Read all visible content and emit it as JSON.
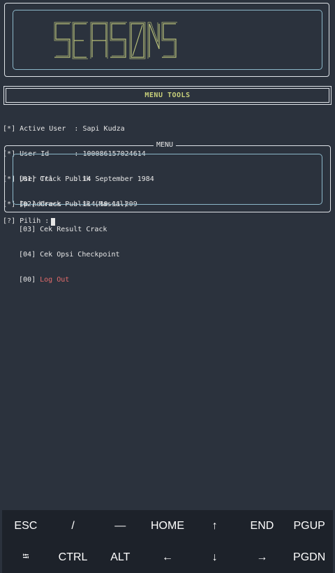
{
  "banner": {
    "logo_text": "SEASONS"
  },
  "menu_tools": {
    "title": "MENU TOOLS"
  },
  "user_info": [
    {
      "marker": "*",
      "label": "Active User",
      "value": "Sapi Kudza"
    },
    {
      "marker": "*",
      "label": "User Id",
      "value": "100086157024614"
    },
    {
      "marker": "*",
      "label": "User Ttl",
      "value": "14 September 1984"
    },
    {
      "marker": "*",
      "label": "Ip Address",
      "value": "114.10.11.209"
    }
  ],
  "menu": {
    "label": "MENU",
    "items": [
      {
        "num": "01",
        "label": "Crack Publik"
      },
      {
        "num": "02",
        "label": "Crack Publik (Massal)"
      },
      {
        "num": "03",
        "label": "Cek Result Crack"
      },
      {
        "num": "04",
        "label": "Cek Opsi Checkpoint"
      },
      {
        "num": "00",
        "label": "Log Out"
      }
    ]
  },
  "prompt": {
    "marker": "?",
    "text": "Pilih :"
  },
  "extra_keys": {
    "row1": [
      "ESC",
      "/",
      "—",
      "HOME",
      "↑",
      "END",
      "PGUP"
    ],
    "row2": [
      "⭾",
      "CTRL",
      "ALT",
      "←",
      "↓",
      "→",
      "PGDN"
    ]
  },
  "colors": {
    "accent": "#c7cf7a",
    "logout": "#e26b6b",
    "inner_border": "#8cb7c9"
  }
}
